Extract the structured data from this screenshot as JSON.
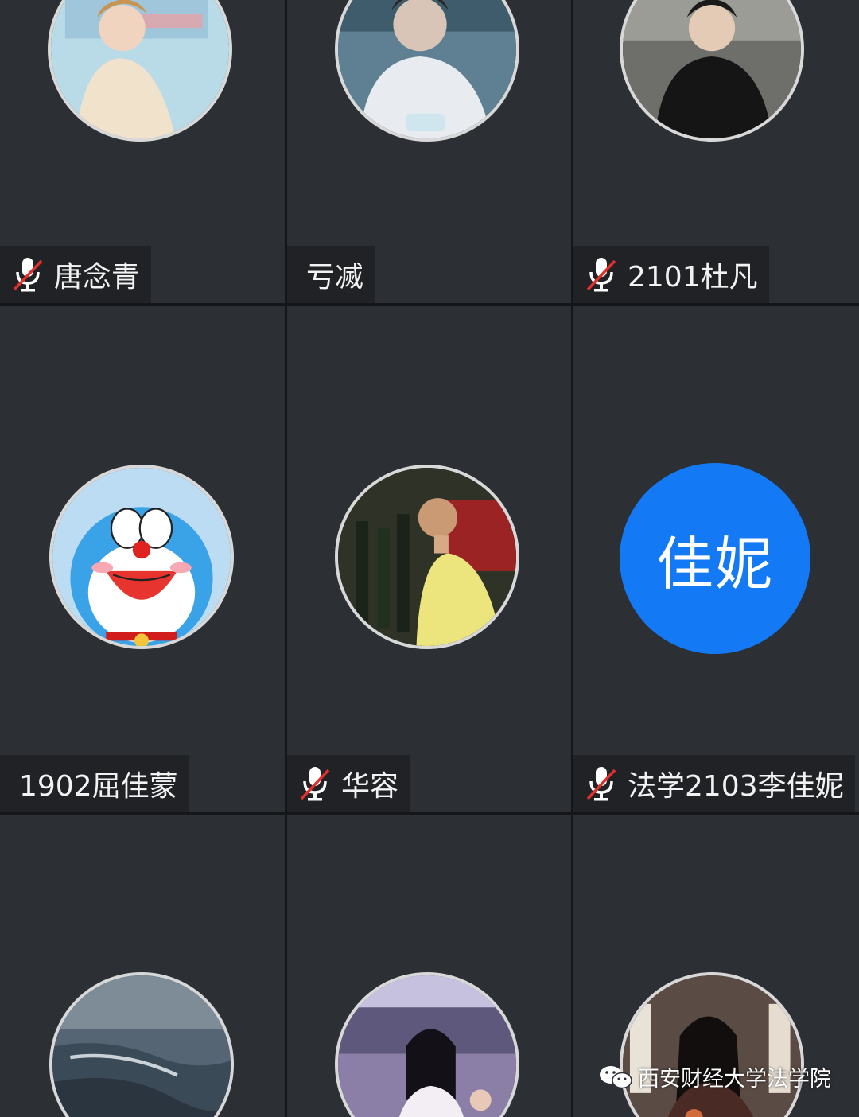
{
  "participants": [
    {
      "name": "唐念青",
      "muted": true,
      "avatar": "photo-girl-blonde"
    },
    {
      "name": "亏㓕",
      "muted": false,
      "avatar": "photo-boy-white-shirt"
    },
    {
      "name": "2101杜凡",
      "muted": true,
      "avatar": "photo-boy-black-shirt"
    },
    {
      "name": "1902屈佳蒙",
      "muted": false,
      "avatar": "cartoon-doraemon"
    },
    {
      "name": "华容",
      "muted": true,
      "avatar": "photo-man-yellow-shirt"
    },
    {
      "name": "法学2103李佳妮",
      "muted": true,
      "avatar_text": "佳妮",
      "avatar": "text-avatar"
    },
    {
      "name": "",
      "muted": false,
      "avatar": "photo-ocean-waves"
    },
    {
      "name": "",
      "muted": false,
      "avatar": "photo-girl-crowd"
    },
    {
      "name": "",
      "muted": false,
      "avatar": "photo-girl-dark-hair"
    }
  ],
  "watermark": {
    "text": "西安财经大学法学院",
    "icon": "wechat-icon"
  },
  "colors": {
    "tile_bg": "#2c2f33",
    "tag_bg": "#202225",
    "avatar_blue": "#1479f5",
    "muted_red": "#e0302c"
  }
}
